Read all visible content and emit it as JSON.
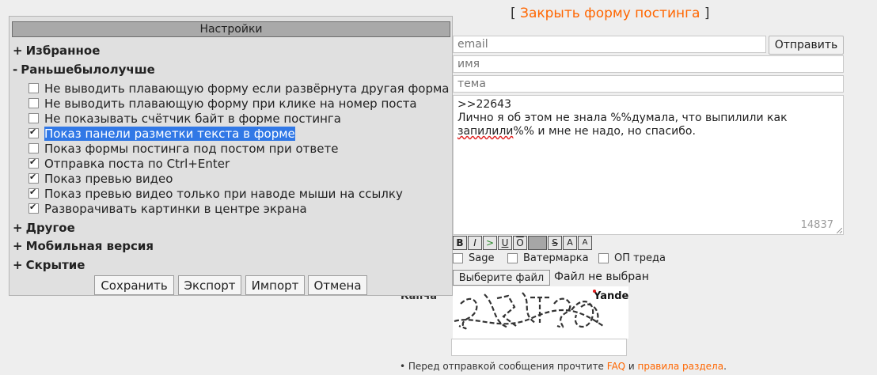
{
  "post_form": {
    "close_link": {
      "bracket_open": "[",
      "label": "Закрыть форму постинга",
      "bracket_close": "]"
    },
    "email_placeholder": "email",
    "name_placeholder": "имя",
    "subject_placeholder": "тема",
    "send_label": "Отправить",
    "comment_lines": [
      ">>22643",
      "Лично я об этом не знала %%думала, что выпилили как",
      "запилили",
      "%% и мне не надо, но спасибо."
    ],
    "char_counter": "14837",
    "markup_buttons": [
      "B",
      "I",
      ">",
      "U",
      "O",
      "",
      "S",
      "A",
      "A"
    ],
    "options": {
      "sage": "Sage",
      "watermark": "Ватермарка",
      "op": "ОП треда"
    },
    "file_button": "Выберите файл",
    "file_status": "Файл не выбран",
    "captcha_label": "Капча",
    "captcha_brand": "Yandex",
    "rules": {
      "prefix": "• Перед отправкой сообщения прочтите",
      "faq": "FAQ",
      "and": "и",
      "rules_link": "правила раздела",
      "suffix": "."
    }
  },
  "settings": {
    "title": "Настройки",
    "sections": {
      "favorites": {
        "sign": "+",
        "label": "Избранное"
      },
      "best": {
        "sign": "-",
        "label": "Раньшебылолучше"
      },
      "other": {
        "sign": "+",
        "label": "Другое"
      },
      "mobile": {
        "sign": "+",
        "label": "Мобильная версия"
      },
      "hiding": {
        "sign": "+",
        "label": "Скрытие"
      }
    },
    "items": [
      {
        "label": "Не выводить плавающую форму если развёрнута другая форма",
        "checked": false
      },
      {
        "label": "Не выводить плавающую форму при клике на номер поста",
        "checked": false
      },
      {
        "label": "Не показывать счётчик байт в форме постинга",
        "checked": false
      },
      {
        "label": "Показ панели разметки текста в форме",
        "checked": true
      },
      {
        "label": "Показ формы постинга под постом при ответе",
        "checked": false
      },
      {
        "label": "Отправка поста по Ctrl+Enter",
        "checked": true
      },
      {
        "label": "Показ превью видео",
        "checked": true
      },
      {
        "label": "Показ превью видео только при наводе мыши на ссылку",
        "checked": true
      },
      {
        "label": "Разворачивать картинки в центре экрана",
        "checked": true
      }
    ],
    "buttons": {
      "save": "Сохранить",
      "export": "Экспорт",
      "import": "Импорт",
      "cancel": "Отмена"
    }
  }
}
